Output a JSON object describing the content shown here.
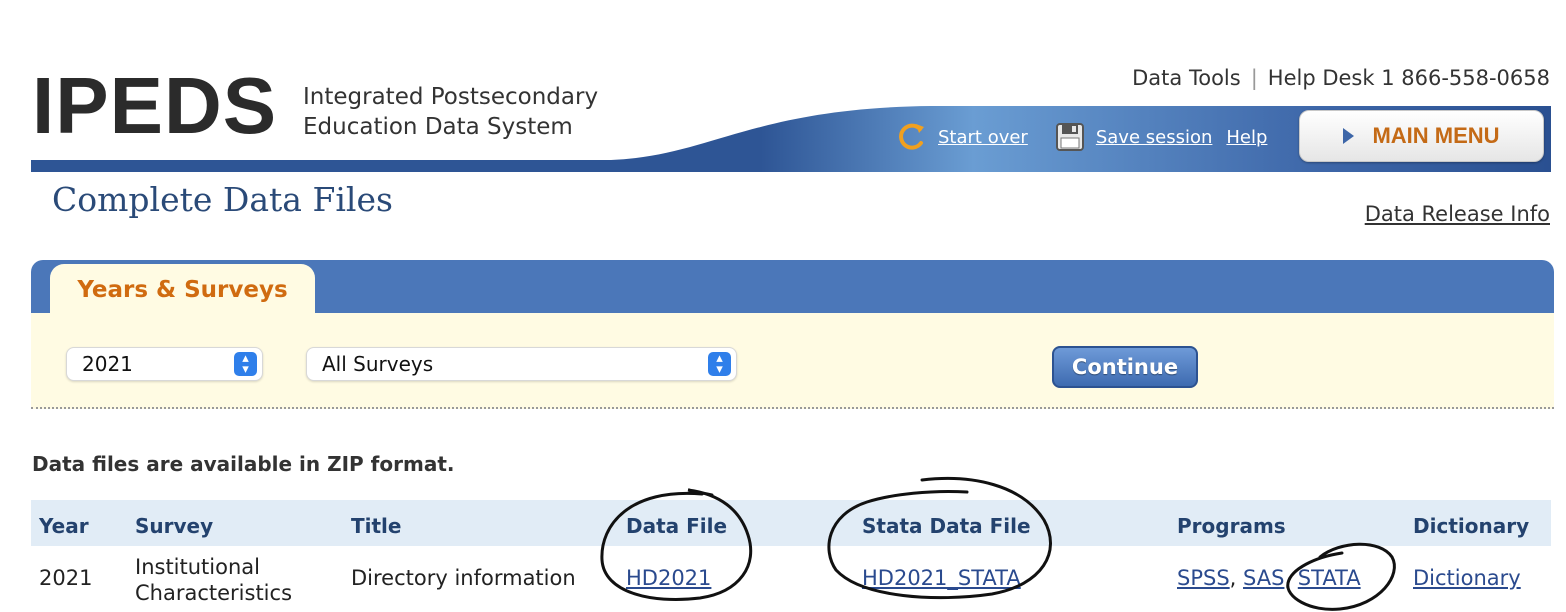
{
  "header": {
    "logo": "IPEDS",
    "tagline_line1": "Integrated Postsecondary",
    "tagline_line2": "Education Data System",
    "data_tools": "Data Tools",
    "separator": "|",
    "help_desk": "Help Desk 1 866-558-0658",
    "start_over": "Start over",
    "save_session": "Save session",
    "help": "Help",
    "main_menu": "MAIN MENU"
  },
  "page": {
    "title": "Complete Data Files",
    "release_info": "Data Release Info"
  },
  "filters": {
    "tab_label": "Years & Surveys",
    "year_value": "2021",
    "survey_value": "All Surveys",
    "continue_label": "Continue"
  },
  "table": {
    "note": "Data files are available in ZIP format.",
    "headers": [
      "Year",
      "Survey",
      "Title",
      "Data File",
      "Stata Data File",
      "Programs",
      "Dictionary"
    ],
    "rows": [
      {
        "year": "2021",
        "survey_line1": "Institutional",
        "survey_line2": "Characteristics",
        "title": "Directory information",
        "data_file": "HD2021",
        "stata_file": "HD2021_STATA",
        "programs": [
          "SPSS",
          "SAS",
          "STATA"
        ],
        "program_sep": ", ",
        "dictionary": "Dictionary"
      }
    ]
  },
  "colors": {
    "banner_blue": "#3d66a8",
    "accent_orange": "#d06b10",
    "panel_bg": "#fffbe3",
    "link_blue": "#2a4a8e"
  }
}
